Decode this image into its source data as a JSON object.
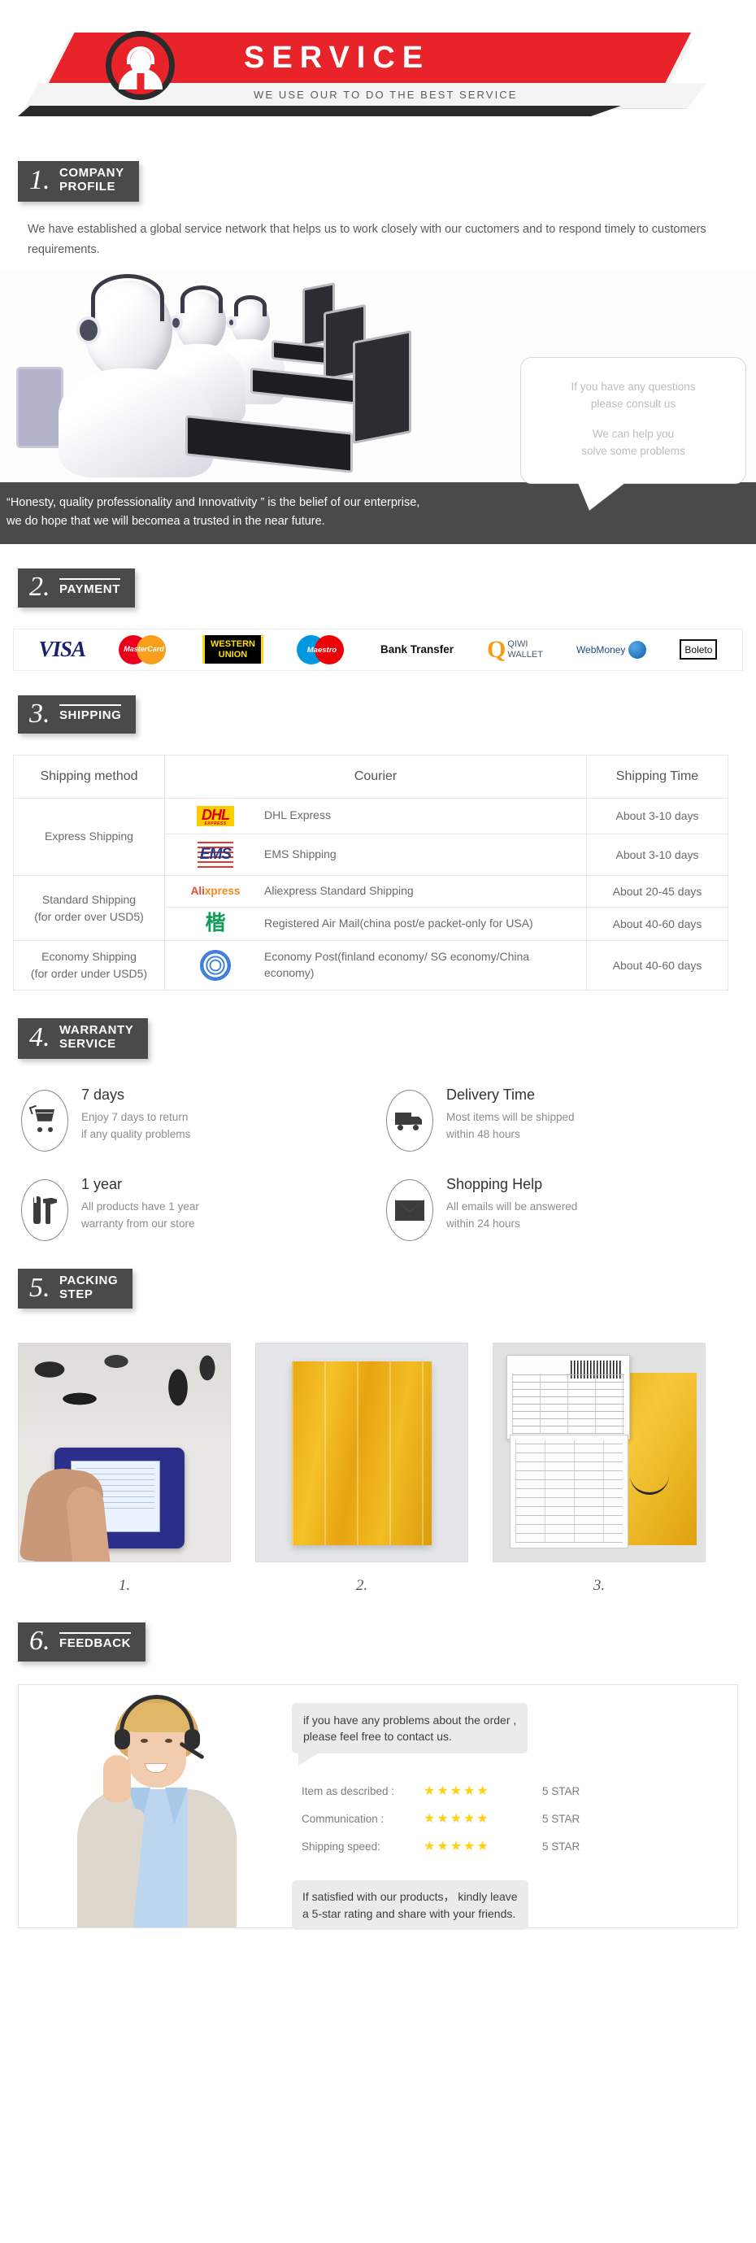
{
  "hero": {
    "title": "SERVICE",
    "subtitle": "WE USE OUR TO DO THE BEST SERVICE",
    "badge_icon": "support-agent-icon",
    "accent_color": "#e8232a",
    "dark_color": "#2b2b2b"
  },
  "sections": {
    "company": {
      "number": "1.",
      "label_line1": "COMPANY",
      "label_line2": "PROFILE",
      "description": "We have established a global service network that helps us to work closely with our cuctomers and to respond timely to customers requirements.",
      "bubble_line1": "If you have any questions",
      "bubble_line2": "please consult us",
      "bubble_line3": "We can help you",
      "bubble_line4": "solve some problems",
      "quote_line1": "“Honesty, quality professionality and Innovativity ”  is the belief of our enterprise,",
      "quote_line2": "we do hope that we will becomea a trusted in the near future."
    },
    "payment": {
      "number": "2.",
      "label": "PAYMENT",
      "methods": [
        {
          "name": "VISA",
          "icon": "visa-logo"
        },
        {
          "name": "MasterCard",
          "icon": "mastercard-logo"
        },
        {
          "name": "WESTERN UNION",
          "icon": "western-union-logo"
        },
        {
          "name": "Maestro",
          "icon": "maestro-logo"
        },
        {
          "name": "Bank Transfer",
          "icon": "bank-transfer-logo"
        },
        {
          "name": "QIWI WALLET",
          "icon": "qiwi-wallet-logo"
        },
        {
          "name": "WebMoney",
          "icon": "webmoney-logo"
        },
        {
          "name": "Boleto",
          "icon": "boleto-logo"
        }
      ],
      "western_union_line1": "WESTERN",
      "western_union_line2": "UNION",
      "qiwi_line1": "QIWI",
      "qiwi_line2": "WALLET",
      "bank_label": "Bank Transfer",
      "webmoney_label": "WebMoney",
      "boleto_label": "Boleto",
      "visa_label": "VISA",
      "mastercard_label": "MasterCard",
      "maestro_label": "Maestro"
    },
    "shipping": {
      "number": "3.",
      "label": "SHIPPING",
      "headers": [
        "Shipping method",
        "Courier",
        "Shipping Time"
      ],
      "rows": [
        {
          "method": "Express Shipping",
          "method_sub": "",
          "couriers": [
            {
              "logo": "dhl-logo",
              "logo_text": "DHL",
              "logo_sub": "EXPRESS",
              "name": "DHL Express",
              "time": "About 3-10 days"
            },
            {
              "logo": "ems-logo",
              "logo_text": "EMS",
              "logo_sub": "",
              "name": "EMS Shipping",
              "time": "About 3-10 days"
            }
          ]
        },
        {
          "method": "Standard Shipping",
          "method_sub": "(for order over USD5)",
          "couriers": [
            {
              "logo": "aliexpress-logo",
              "logo_text": "Ali",
              "logo_sub": "xpress",
              "name": "Aliexpress Standard Shipping",
              "time": "About 20-45 days"
            },
            {
              "logo": "china-post-logo",
              "logo_text": "",
              "logo_sub": "",
              "name": "Registered Air Mail(china post/e packet-only for USA)",
              "time": "About 40-60 days"
            }
          ]
        },
        {
          "method": "Economy Shipping",
          "method_sub": "(for order under USD5)",
          "couriers": [
            {
              "logo": "un-globe-logo",
              "logo_text": "",
              "logo_sub": "",
              "name": "Economy Post(finland economy/ SG economy/China economy)",
              "time": "About 40-60 days"
            }
          ]
        }
      ]
    },
    "warranty": {
      "number": "4.",
      "label_line1": "WARRANTY",
      "label_line2": "SERVICE",
      "items": [
        {
          "icon": "shopping-cart-icon",
          "title": "7 days",
          "desc_line1": "Enjoy 7 days to return",
          "desc_line2": "if any quality problems"
        },
        {
          "icon": "delivery-truck-icon",
          "title": "Delivery Time",
          "desc_line1": "Most items will be shipped",
          "desc_line2": "within 48 hours"
        },
        {
          "icon": "tools-icon",
          "title": "1 year",
          "desc_line1": "All products have 1 year",
          "desc_line2": "warranty from our store"
        },
        {
          "icon": "envelope-icon",
          "title": "Shopping Help",
          "desc_line1": "All emails will be answered",
          "desc_line2": "within 24 hours"
        }
      ]
    },
    "packing": {
      "number": "5.",
      "label_line1": "PACKING",
      "label_line2": "STEP",
      "steps": [
        {
          "caption": "1.",
          "alt": "diagnostic-device-photo"
        },
        {
          "caption": "2.",
          "alt": "yellow-envelope-photo"
        },
        {
          "caption": "3.",
          "alt": "labelled-parcel-photo"
        }
      ]
    },
    "feedback": {
      "number": "6.",
      "label": "FEEDBACK",
      "photo_alt": "call-center-agent-photo",
      "bubble_line1": "if you have any problems about the order ,",
      "bubble_line2": "please feel free to contact us.",
      "ratings": [
        {
          "label": "Item as described :",
          "stars": "★★★★★",
          "value": "5 STAR"
        },
        {
          "label": "Communication :",
          "stars": "★★★★★",
          "value": "5 STAR"
        },
        {
          "label": "Shipping speed:",
          "stars": "★★★★★",
          "value": "5 STAR"
        }
      ],
      "note_line1": "If satisfied with our products， kindly leave",
      "note_line2": "a 5-star rating and share with your friends."
    }
  }
}
